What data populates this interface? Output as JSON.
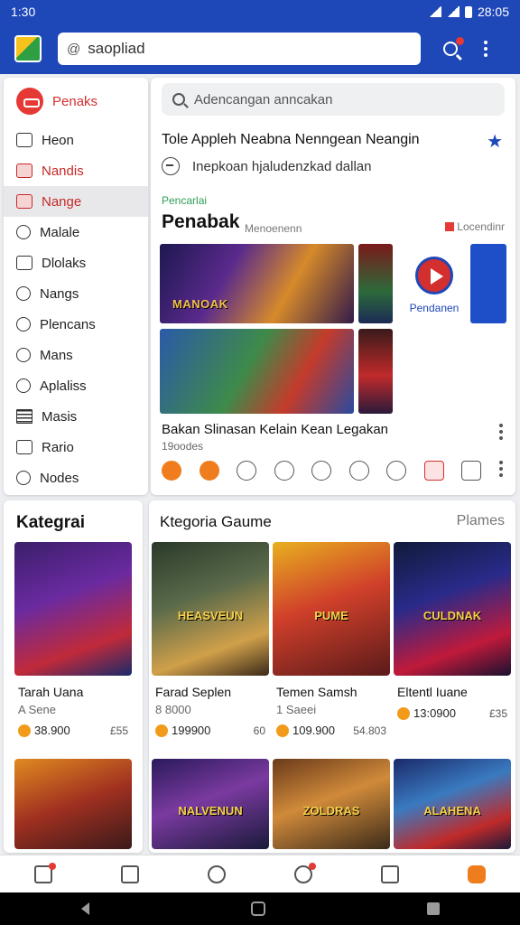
{
  "status": {
    "time": "1:30",
    "right": "28:05"
  },
  "topbar": {
    "search_value": "saopliad",
    "at_symbol": "@"
  },
  "sidebar": {
    "header": "Penaks",
    "items": [
      {
        "label": "Heon"
      },
      {
        "label": "Nandis"
      },
      {
        "label": "Nange"
      },
      {
        "label": "Malale"
      },
      {
        "label": "Dlolaks"
      },
      {
        "label": "Nangs"
      },
      {
        "label": "Plencans"
      },
      {
        "label": "Mans"
      },
      {
        "label": "Aplaliss"
      },
      {
        "label": "Masis"
      },
      {
        "label": "Rario"
      },
      {
        "label": "Nodes"
      }
    ]
  },
  "feed": {
    "search_placeholder": "Adencangan anncakan",
    "headline": "Tole Appleh Neabna Nenngean Neangin",
    "subline": "Inepkoan hjaludenzkad dallan",
    "section_small": "Pencarlai",
    "section_title": "Penabak",
    "section_sub": "Menoenenn",
    "section_right": "Locendinr",
    "art_title": "MANOAK",
    "promo_label": "Pendanen",
    "card_title": "Bakan Slinasan Kelain Kean Legakan",
    "card_sub": "19oodes"
  },
  "categories": {
    "title": "Kategrai"
  },
  "games": {
    "title": "Ktegoria Gaume",
    "link": "Plames",
    "items": [
      {
        "thumb": "",
        "name": "Tarah Uana",
        "sub": "A Sene",
        "price": "38.900",
        "extra": "£55"
      },
      {
        "thumb": "HEASVEUN",
        "name": "Farad Seplen",
        "sub": "8 8000",
        "price": "199900",
        "extra": "60"
      },
      {
        "thumb": "PUME",
        "name": "Temen Samsh",
        "sub": "1 Saeei",
        "price": "109.900",
        "extra": "54.803"
      },
      {
        "thumb": "CULDNAK",
        "name": "Eltentl Iuane",
        "sub": "",
        "price": "13:0900",
        "extra": "£35"
      },
      {
        "thumb": "",
        "name": "",
        "sub": "",
        "price": "",
        "extra": ""
      },
      {
        "thumb": "NALVENUN",
        "name": "",
        "sub": "",
        "price": "",
        "extra": ""
      },
      {
        "thumb": "ZOLDRAS",
        "name": "",
        "sub": "",
        "price": "",
        "extra": ""
      },
      {
        "thumb": "ALAHENA",
        "name": "",
        "sub": "",
        "price": "",
        "extra": ""
      }
    ]
  },
  "colors": {
    "brand_blue": "#1e47b8",
    "accent_red": "#d32f2f",
    "accent_orange": "#ef7d1d",
    "section_green": "#2e9d55"
  }
}
